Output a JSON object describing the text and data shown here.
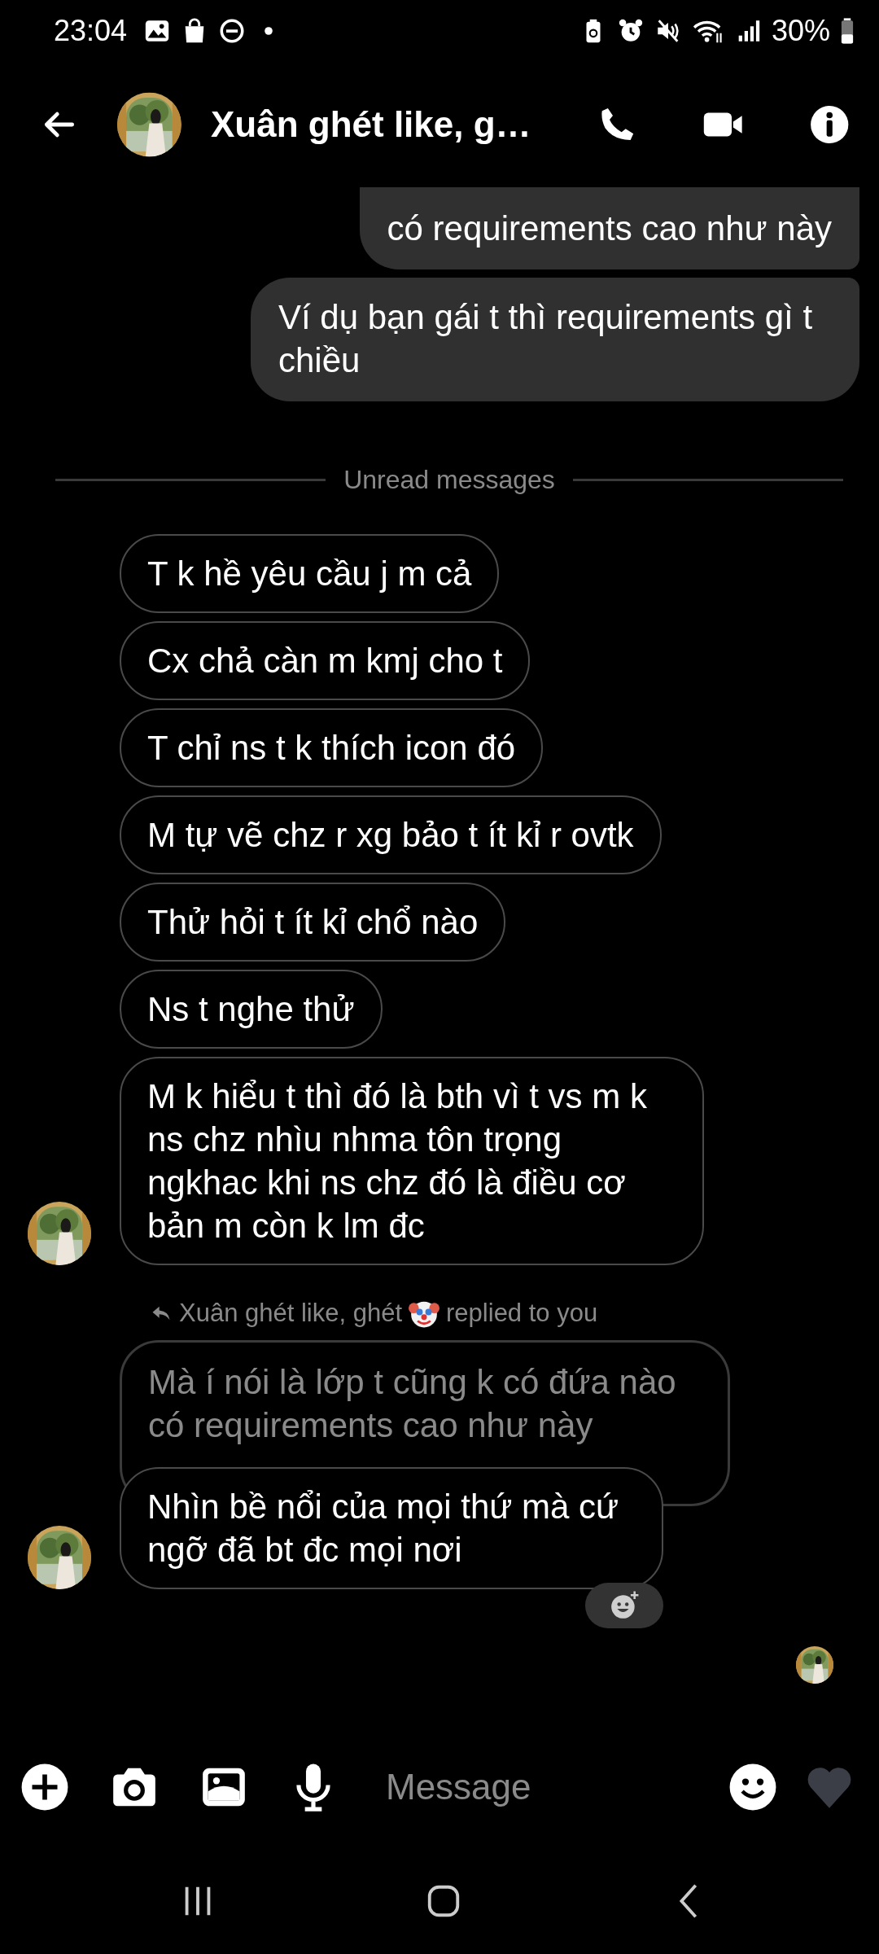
{
  "status_bar": {
    "time": "23:04",
    "battery": "30%"
  },
  "header": {
    "title": "Xuân ghét like, g…"
  },
  "sent": [
    {
      "text": "có requirements cao như này",
      "partial": true
    },
    {
      "text": "Ví dụ bạn gái t thì requirements gì t chiều",
      "partial": false
    }
  ],
  "divider": "Unread messages",
  "received": [
    {
      "text": "T k hề yêu cầu j m cả"
    },
    {
      "text": "Cx chả càn m kmj cho t"
    },
    {
      "text": "T chỉ ns t k thích icon đó"
    },
    {
      "text": "M tự vẽ chz r xg bảo t ít kỉ r ovtk"
    },
    {
      "text": "Thử hỏi t ít kỉ chổ nào"
    },
    {
      "text": "Ns t nghe thử"
    },
    {
      "text": "M k hiểu t thì đó là bth vì t vs m k ns chz nhìu nhma tôn trọng ngkhac khi ns chz đó là điều cơ bản m còn k lm đc"
    }
  ],
  "reply": {
    "label_before": "Xuân ghét like, ghét",
    "label_after": "replied to you",
    "quoted": "Mà í nói là lớp t cũng k có đứa nào có requirements cao như này",
    "text": "Nhìn bề nổi của mọi thứ mà cứ ngỡ đã bt đc mọi nơi"
  },
  "composer": {
    "placeholder": "Message"
  }
}
